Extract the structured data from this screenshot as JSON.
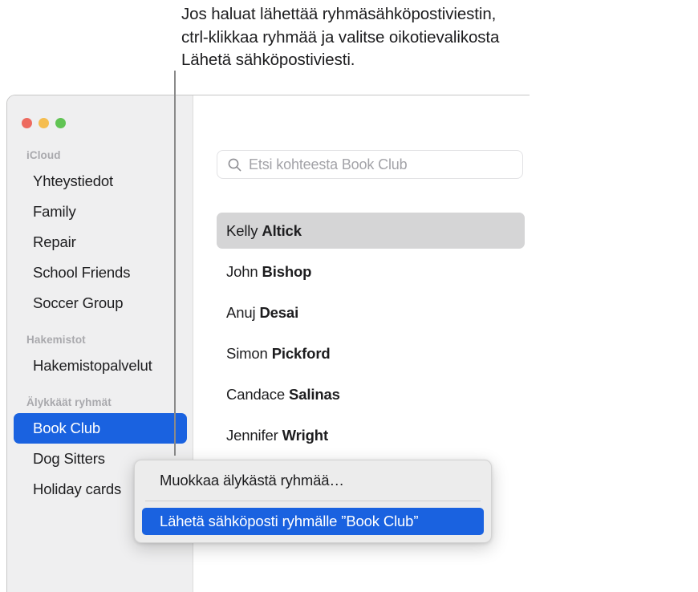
{
  "callout": {
    "caption": "Jos haluat lähettää ryhmäsähköpostiviestin,\nctrl-klikkaa ryhmää ja valitse oikotievalikosta\nLähetä sähköpostiviesti.",
    "line_name": "callout-leader-line"
  },
  "colors": {
    "accent_blue": "#1a62e0",
    "sidebar_bg": "#efeff0",
    "menu_bg": "#ececec",
    "selected_row_gray": "#d5d5d6",
    "section_header_gray": "#a9a9ad",
    "traffic_red": "#ed6a5f",
    "traffic_yellow": "#f5bd4f",
    "traffic_green": "#61c454"
  },
  "window": {
    "traffic_lights": [
      {
        "name": "close-button",
        "color": "#ed6a5f"
      },
      {
        "name": "minimize-button",
        "color": "#f5bd4f"
      },
      {
        "name": "maximize-button",
        "color": "#61c454"
      }
    ]
  },
  "sidebar": {
    "sections": [
      {
        "header": "iCloud",
        "items": [
          {
            "label": "Yhteystiedot",
            "selected": false
          },
          {
            "label": "Family",
            "selected": false
          },
          {
            "label": "Repair",
            "selected": false
          },
          {
            "label": "School Friends",
            "selected": false
          },
          {
            "label": "Soccer Group",
            "selected": false
          }
        ]
      },
      {
        "header": "Hakemistot",
        "items": [
          {
            "label": "Hakemistopalvelut",
            "selected": false
          }
        ]
      },
      {
        "header": "Älykkäät ryhmät",
        "items": [
          {
            "label": "Book Club",
            "selected": true
          },
          {
            "label": "Dog Sitters",
            "selected": false
          },
          {
            "label": "Holiday cards",
            "selected": false
          }
        ]
      }
    ]
  },
  "search": {
    "placeholder": "Etsi kohteesta Book Club",
    "value": "",
    "icon": "search-icon"
  },
  "contacts": {
    "rows": [
      {
        "first": "Kelly",
        "last": "Altick",
        "selected": true
      },
      {
        "first": "John",
        "last": "Bishop",
        "selected": false
      },
      {
        "first": "Anuj",
        "last": "Desai",
        "selected": false
      },
      {
        "first": "Simon",
        "last": "Pickford",
        "selected": false
      },
      {
        "first": "Candace",
        "last": "Salinas",
        "selected": false
      },
      {
        "first": "Jennifer",
        "last": "Wright",
        "selected": false
      }
    ]
  },
  "context_menu": {
    "items": [
      {
        "label": "Muokkaa älykästä ryhmää…",
        "highlighted": false,
        "separator_after": true
      },
      {
        "label": "Lähetä sähköposti ryhmälle ”Book Club”",
        "highlighted": true,
        "separator_after": false
      }
    ]
  }
}
